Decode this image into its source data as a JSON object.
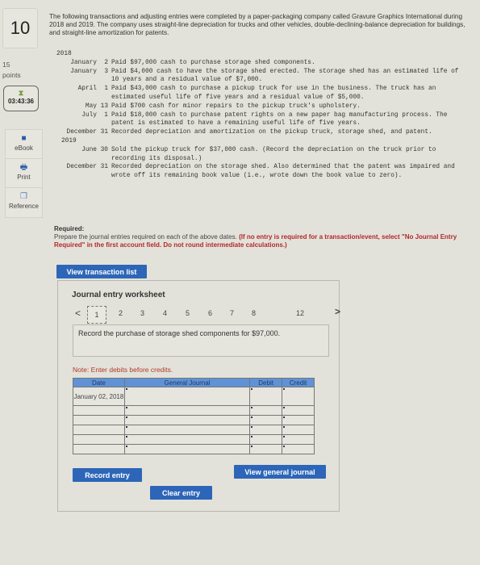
{
  "question": {
    "number": "10",
    "points_value": "15",
    "points_label": "points",
    "timer": "03:43:36",
    "intro": "The following transactions and adjusting entries were completed by a paper-packaging company called Gravure Graphics International during 2018 and 2019. The company uses straight-line depreciation for trucks and other vehicles, double-declining-balance depreciation for buildings, and straight-line amortization for patents."
  },
  "sidebar": {
    "ebook": "eBook",
    "print": "Print",
    "reference": "Reference"
  },
  "transactions": {
    "year1": "2018",
    "year1_rows": [
      {
        "date": "January  2",
        "text": "Paid $97,000 cash to purchase storage shed components."
      },
      {
        "date": "January  3",
        "text": "Paid $4,000 cash to have the storage shed erected. The storage shed has an estimated life of 10 years and a residual value of $7,000."
      },
      {
        "date": "April  1",
        "text": "Paid $43,000 cash to purchase a pickup truck for use in the business. The truck has an estimated useful life of five years and a residual value of $5,000."
      },
      {
        "date": "May 13",
        "text": "Paid $700 cash for minor repairs to the pickup truck's upholstery."
      },
      {
        "date": "July  1",
        "text": "Paid $18,000 cash to purchase patent rights on a new paper bag manufacturing process. The patent is estimated to have a remaining useful life of five years."
      },
      {
        "date": "December 31",
        "text": "Recorded depreciation and amortization on the pickup truck, storage shed, and patent."
      }
    ],
    "year2": "2019",
    "year2_rows": [
      {
        "date": "June 30",
        "text": "Sold the pickup truck for $37,000 cash. (Record the depreciation on the truck prior to recording its disposal.)"
      },
      {
        "date": "December 31",
        "text": "Recorded depreciation on the storage shed. Also determined that the patent was impaired and wrote off its remaining book value (i.e., wrote down the book value to zero)."
      }
    ]
  },
  "required": {
    "label": "Required:",
    "text": "Prepare the journal entries required on each of the above dates.",
    "instruction": "(If no entry is required for a transaction/event, select \"No Journal Entry Required\" in the first account field. Do not round intermediate calculations.)"
  },
  "buttons": {
    "view_transaction_list": "View transaction list",
    "record_entry": "Record entry",
    "clear_entry": "Clear entry",
    "view_general_journal": "View general journal"
  },
  "worksheet": {
    "title": "Journal entry worksheet",
    "prev": "<",
    "next": ">",
    "pages": [
      "1",
      "2",
      "3",
      "4",
      "5",
      "6",
      "7",
      "8",
      "12"
    ],
    "current_page": "1",
    "description": "Record the purchase of storage shed components for $97,000.",
    "note": "Note: Enter debits before credits.",
    "columns": [
      "Date",
      "General Journal",
      "Debit",
      "Credit"
    ],
    "rows": [
      {
        "date": "January 02, 2018",
        "account": "",
        "debit": "",
        "credit": ""
      },
      {
        "date": "",
        "account": "",
        "debit": "",
        "credit": ""
      },
      {
        "date": "",
        "account": "",
        "debit": "",
        "credit": ""
      },
      {
        "date": "",
        "account": "",
        "debit": "",
        "credit": ""
      },
      {
        "date": "",
        "account": "",
        "debit": "",
        "credit": ""
      },
      {
        "date": "",
        "account": "",
        "debit": "",
        "credit": ""
      }
    ]
  }
}
